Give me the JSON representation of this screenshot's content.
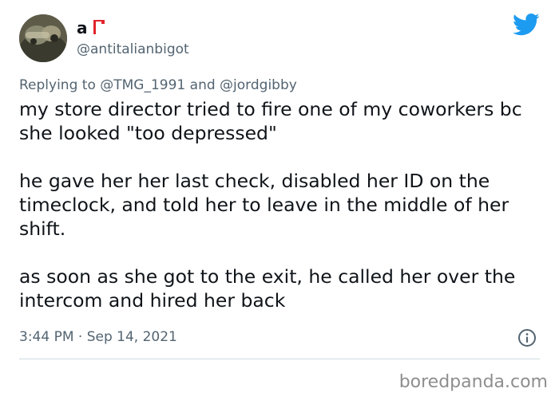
{
  "author": {
    "display_name": "a",
    "handle": "@antitalianbigot"
  },
  "reply": {
    "prefix": "Replying to",
    "mention_1": "@TMG_1991",
    "conjunction": "and",
    "mention_2": "@jordgibby"
  },
  "tweet": {
    "text": "my store director tried to fire one of my coworkers bc she looked \"too depressed\"\n\nhe gave her her last check, disabled her ID on the timeclock, and told her to leave in the middle of her shift.\n\nas soon as she got to the exit, he called her over the intercom and hired her back",
    "time": "3:44 PM",
    "separator": "·",
    "date": "Sep 14, 2021"
  },
  "watermark": "boredpanda.com",
  "icons": {
    "logo": "twitter-bird-icon",
    "info": "info-icon",
    "badge": "red-flag-emoji"
  },
  "colors": {
    "twitter_blue": "#1d9bf0",
    "secondary_text": "#536471",
    "primary_text": "#0f1419",
    "badge_red": "#e0242b",
    "watermark": "#8e8e8e"
  }
}
